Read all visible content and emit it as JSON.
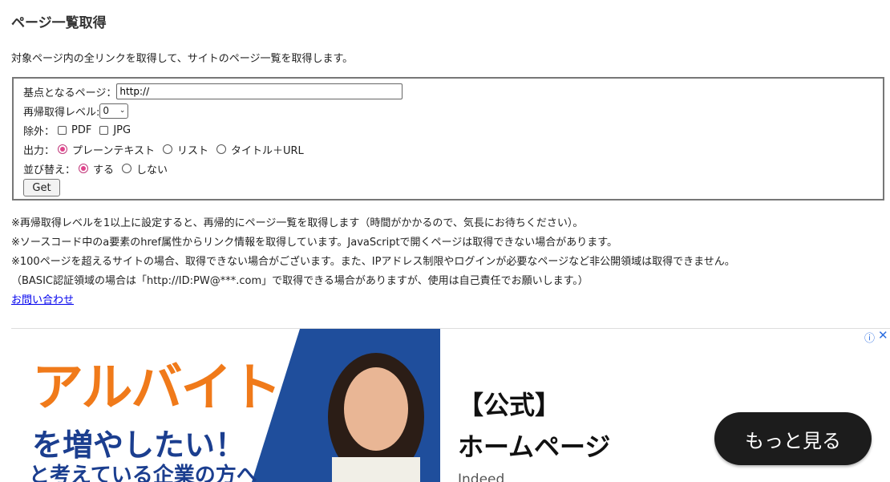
{
  "page": {
    "title": "ページ一覧取得",
    "lead": "対象ページ内の全リンクを取得して、サイトのページ一覧を取得します。"
  },
  "form": {
    "base_label": "基点となるページ：",
    "base_value": "http://",
    "level_label": "再帰取得レベル:",
    "level_value": "0",
    "exclude_label": "除外：",
    "exclude_options": [
      "PDF",
      "JPG"
    ],
    "output_label": "出力：",
    "output_options": [
      "プレーンテキスト",
      "リスト",
      "タイトル＋URL"
    ],
    "output_selected": "プレーンテキスト",
    "sort_label": "並び替え：",
    "sort_options": [
      "する",
      "しない"
    ],
    "sort_selected": "する",
    "submit_label": "Get"
  },
  "notes": [
    "※再帰取得レベルを1以上に設定すると、再帰的にページ一覧を取得します（時間がかかるので、気長にお待ちください）。",
    "※ソースコード中のa要素のhref属性からリンク情報を取得しています。JavaScriptで開くページは取得できない場合があります。",
    "※100ページを超えるサイトの場合、取得できない場合がございます。また、IPアドレス制限やログインが必要なページなど非公開領域は取得できません。",
    "（BASIC認証領域の場合は「http://ID:PW@***.com」で取得できる場合がありますが、使用は自己責任でお願いします。）"
  ],
  "contact_link": "お問い合わせ",
  "ad": {
    "image_headline": "アルバイト",
    "image_sub": "を増やしたい！",
    "image_sub2": "と考えている企業の方へ",
    "title_line1": "【公式】",
    "title_line2": "ホームページ",
    "sponsor": "Indeed",
    "cta": "もっと見る",
    "colors": {
      "blue": "#1f4e9c",
      "orange": "#f07a1a",
      "cta": "#1c1c1c"
    }
  }
}
